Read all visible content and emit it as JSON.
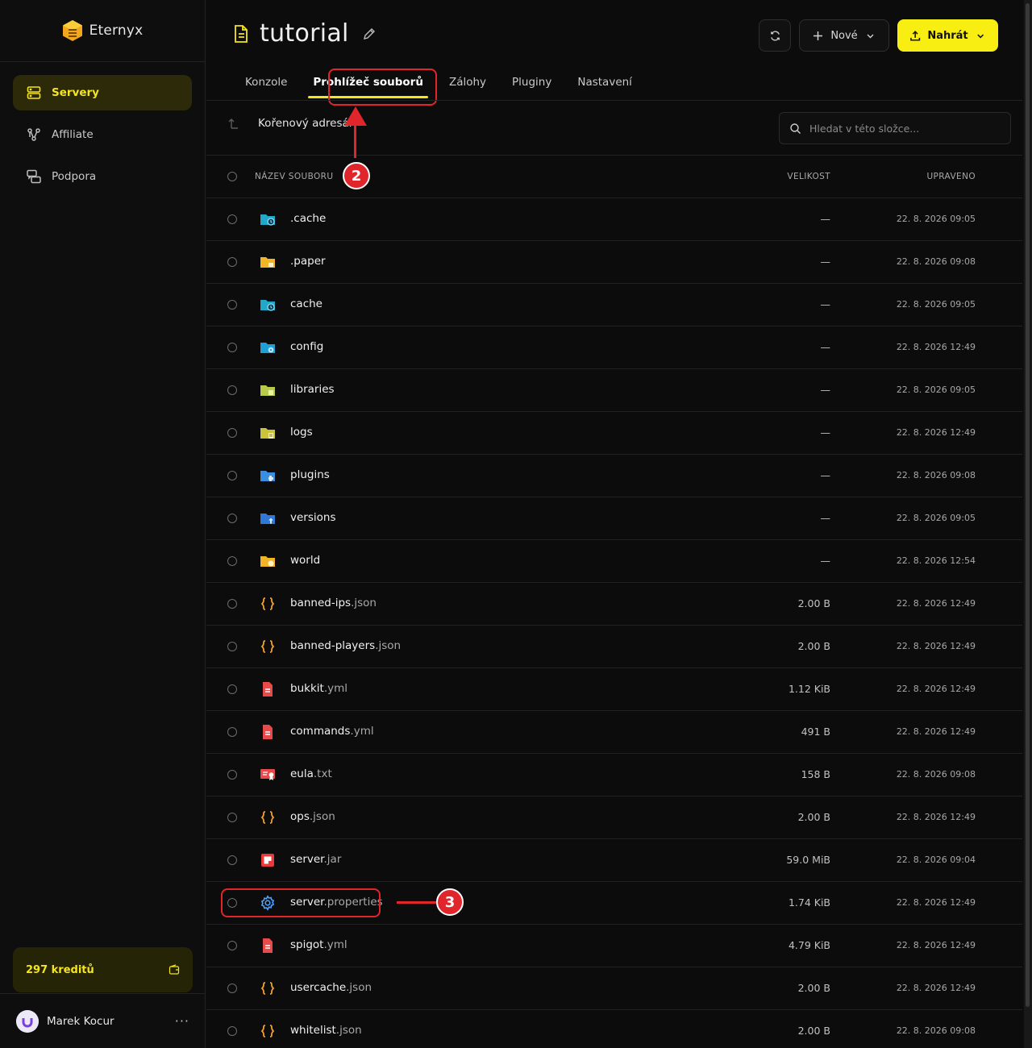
{
  "brand": {
    "name": "Eternyx"
  },
  "sidebar": {
    "items": [
      {
        "label": "Servery",
        "icon": "server-icon",
        "active": true
      },
      {
        "label": "Affiliate",
        "icon": "affiliate-icon",
        "active": false
      },
      {
        "label": "Podpora",
        "icon": "support-icon",
        "active": false
      }
    ],
    "credits": "297 kreditů",
    "user": {
      "name": "Marek Kocur",
      "more": "···"
    }
  },
  "header": {
    "title": "tutorial",
    "new_label": "Nové",
    "upload_label": "Nahrát"
  },
  "tabs": [
    {
      "label": "Konzole"
    },
    {
      "label": "Prohlížeč souborů",
      "active": true
    },
    {
      "label": "Zálohy"
    },
    {
      "label": "Pluginy"
    },
    {
      "label": "Nastavení"
    }
  ],
  "breadcrumb": {
    "label": "Kořenový adresář"
  },
  "search": {
    "placeholder": "Hledat v této složce..."
  },
  "table": {
    "headers": {
      "name": "NÁZEV SOUBORU",
      "size": "VELIKOST",
      "modified": "UPRAVENO"
    },
    "rows": [
      {
        "base": ".cache",
        "ext": "",
        "size": "—",
        "modified": "22. 8. 2026 09:05",
        "icon": "folder-clock-icon"
      },
      {
        "base": ".paper",
        "ext": "",
        "size": "—",
        "modified": "22. 8. 2026 09:08",
        "icon": "folder-yellow-icon"
      },
      {
        "base": "cache",
        "ext": "",
        "size": "—",
        "modified": "22. 8. 2026 09:05",
        "icon": "folder-clock-icon"
      },
      {
        "base": "config",
        "ext": "",
        "size": "—",
        "modified": "22. 8. 2026 12:49",
        "icon": "folder-config-icon"
      },
      {
        "base": "libraries",
        "ext": "",
        "size": "—",
        "modified": "22. 8. 2026 09:05",
        "icon": "folder-lib-icon"
      },
      {
        "base": "logs",
        "ext": "",
        "size": "—",
        "modified": "22. 8. 2026 12:49",
        "icon": "folder-logs-icon"
      },
      {
        "base": "plugins",
        "ext": "",
        "size": "—",
        "modified": "22. 8. 2026 09:08",
        "icon": "folder-plugin-icon"
      },
      {
        "base": "versions",
        "ext": "",
        "size": "—",
        "modified": "22. 8. 2026 09:05",
        "icon": "folder-versions-icon"
      },
      {
        "base": "world",
        "ext": "",
        "size": "—",
        "modified": "22. 8. 2026 12:54",
        "icon": "folder-world-icon"
      },
      {
        "base": "banned-ips",
        "ext": ".json",
        "size": "2.00 B",
        "modified": "22. 8. 2026 12:49",
        "icon": "json-icon"
      },
      {
        "base": "banned-players",
        "ext": ".json",
        "size": "2.00 B",
        "modified": "22. 8. 2026 12:49",
        "icon": "json-icon"
      },
      {
        "base": "bukkit",
        "ext": ".yml",
        "size": "1.12 KiB",
        "modified": "22. 8. 2026 12:49",
        "icon": "yml-icon"
      },
      {
        "base": "commands",
        "ext": ".yml",
        "size": "491 B",
        "modified": "22. 8. 2026 12:49",
        "icon": "yml-icon"
      },
      {
        "base": "eula",
        "ext": ".txt",
        "size": "158 B",
        "modified": "22. 8. 2026 09:08",
        "icon": "license-icon"
      },
      {
        "base": "ops",
        "ext": ".json",
        "size": "2.00 B",
        "modified": "22. 8. 2026 12:49",
        "icon": "json-icon"
      },
      {
        "base": "server",
        "ext": ".jar",
        "size": "59.0 MiB",
        "modified": "22. 8. 2026 09:04",
        "icon": "jar-icon"
      },
      {
        "base": "server",
        "ext": ".properties",
        "size": "1.74 KiB",
        "modified": "22. 8. 2026 12:49",
        "icon": "gear-icon"
      },
      {
        "base": "spigot",
        "ext": ".yml",
        "size": "4.79 KiB",
        "modified": "22. 8. 2026 12:49",
        "icon": "yml-icon"
      },
      {
        "base": "usercache",
        "ext": ".json",
        "size": "2.00 B",
        "modified": "22. 8. 2026 12:49",
        "icon": "json-icon"
      },
      {
        "base": "whitelist",
        "ext": ".json",
        "size": "2.00 B",
        "modified": "22. 8. 2026 09:08",
        "icon": "json-icon"
      }
    ]
  },
  "annotations": {
    "step2": "2",
    "step3": "3"
  },
  "colors": {
    "accent": "#f9ee12",
    "annotation": "#e0262b"
  }
}
